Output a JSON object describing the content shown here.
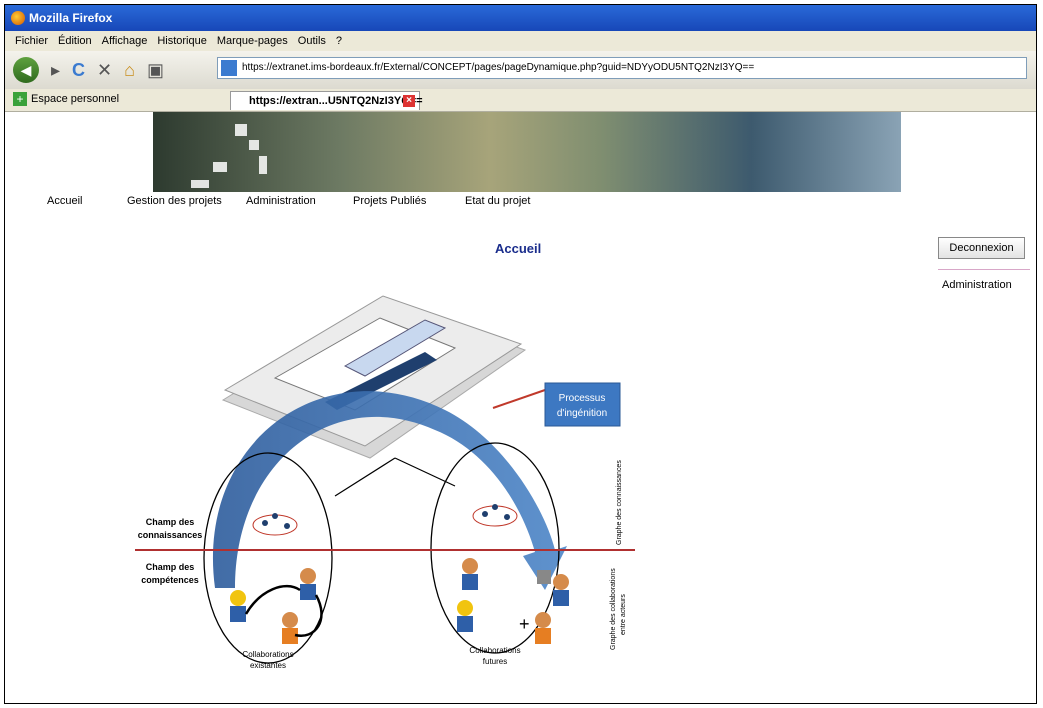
{
  "window": {
    "title": "Mozilla Firefox"
  },
  "menu": [
    "Fichier",
    "Édition",
    "Affichage",
    "Historique",
    "Marque-pages",
    "Outils",
    "?"
  ],
  "address": {
    "url": "https://extranet.ims-bordeaux.fr/External/CONCEPT/pages/pageDynamique.php?guid=NDYyODU5NTQ2NzI3YQ=="
  },
  "bookmarks": {
    "item": "Espace personnel"
  },
  "tab": {
    "title": "https://extran...U5NTQ2NzI3YQ=="
  },
  "site_nav": [
    "Accueil",
    "Gestion des projets",
    "Administration",
    "Projets Publiés",
    "Etat du projet"
  ],
  "page": {
    "title": "Accueil"
  },
  "sidebar": {
    "logout": "Deconnexion",
    "admin_link": "Administration"
  },
  "diagram": {
    "process_box": [
      "Processus",
      "d'ingénition"
    ],
    "champ_connaissances": [
      "Champ des",
      "connaissances"
    ],
    "champ_competences": [
      "Champ des",
      "compétences"
    ],
    "collab_existantes": [
      "Collaborations",
      "existantes"
    ],
    "collab_futures": [
      "Collaborations",
      "futures"
    ],
    "vertical_label_top": "Graphe des connaissances",
    "vertical_label_bottom": [
      "Graphe des collaborations",
      "entre acteurs"
    ],
    "plus": "+"
  },
  "colors": {
    "arrow": "#3a6fb0",
    "process_box": "#3d78c2",
    "divider": "#b03030",
    "title": "#1a2d8c"
  }
}
